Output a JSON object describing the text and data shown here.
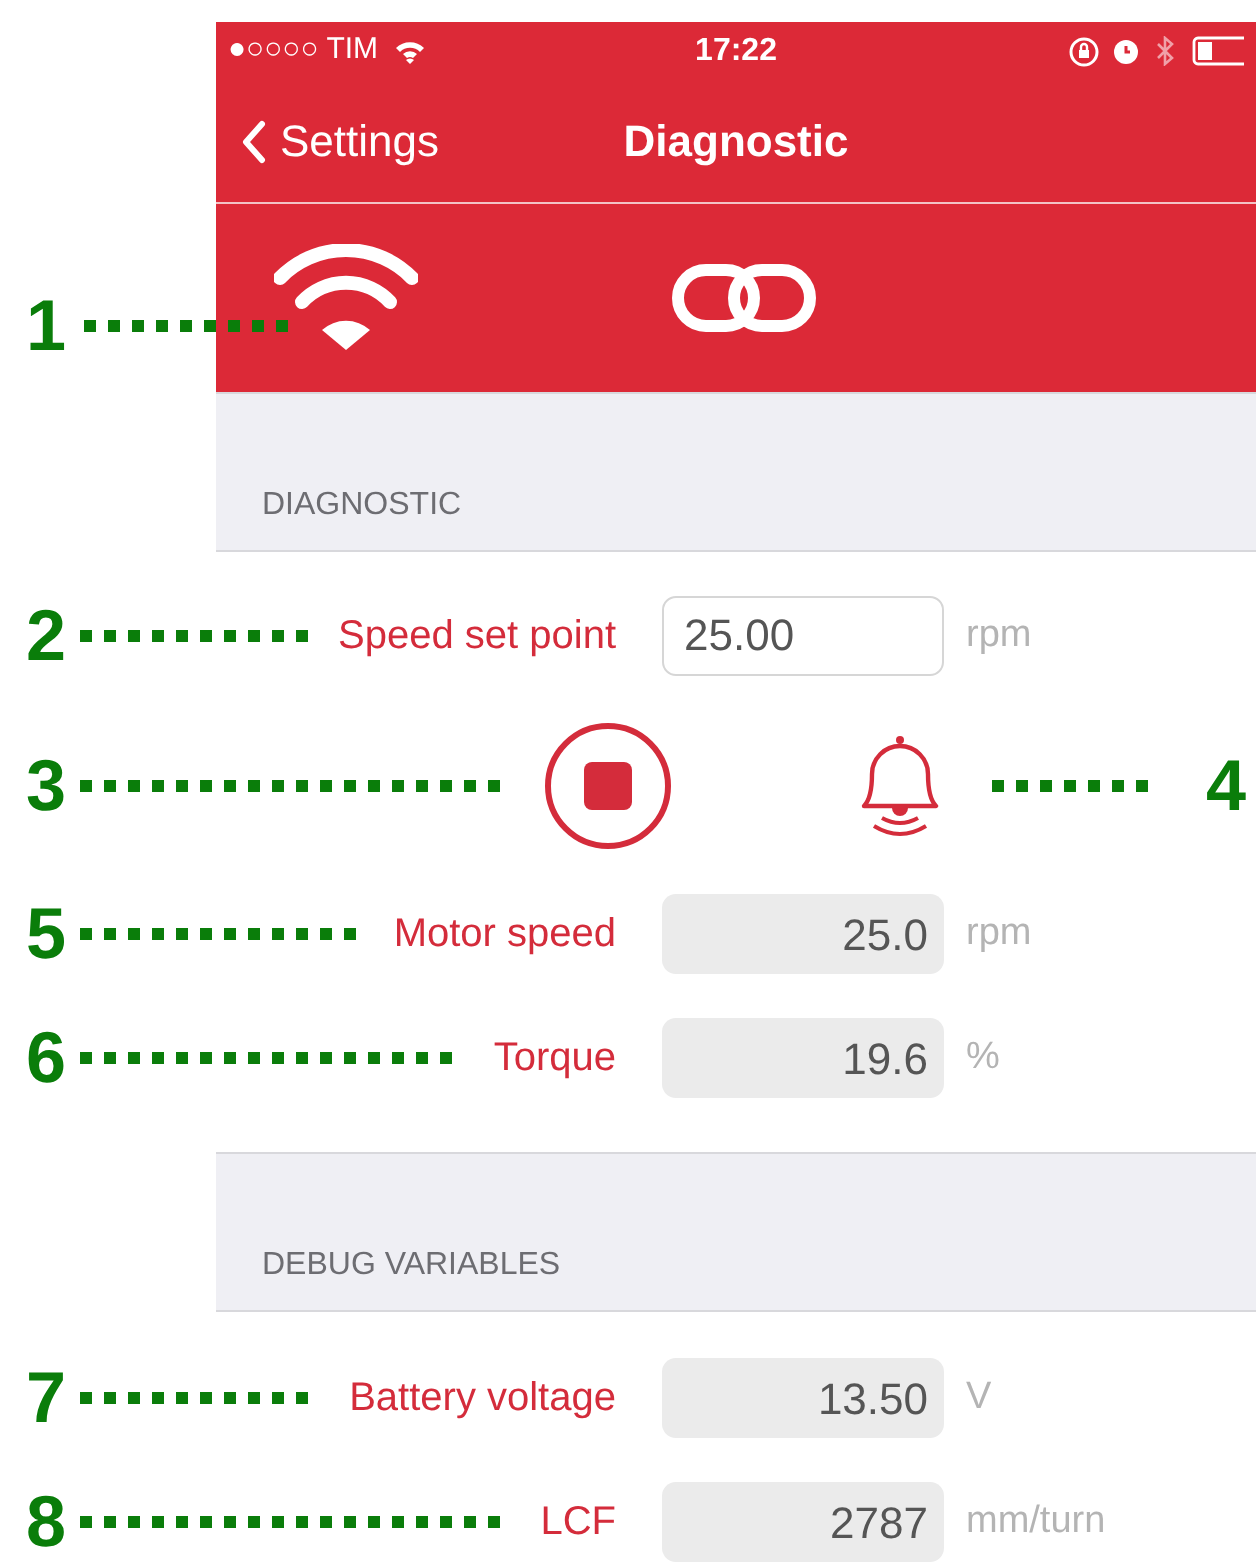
{
  "status_bar": {
    "carrier": "●○○○○ TIM",
    "time": "17:22"
  },
  "nav_bar": {
    "back": "Settings",
    "title": "Diagnostic"
  },
  "toolbar": {
    "callout": "1"
  },
  "sections": [
    {
      "header": "DIAGNOSTIC",
      "rows": [
        {
          "kind": "input",
          "callout": "2",
          "label": "Speed set point",
          "value": "25.00",
          "unit": "rpm"
        },
        {
          "kind": "actions",
          "callouts": [
            "3",
            "4"
          ]
        },
        {
          "kind": "readout",
          "callout": "5",
          "label": "Motor speed",
          "value": "25.0",
          "unit": "rpm"
        },
        {
          "kind": "readout",
          "callout": "6",
          "label": "Torque",
          "value": "19.6",
          "unit": "%"
        }
      ]
    },
    {
      "header": "DEBUG VARIABLES",
      "rows": [
        {
          "kind": "readout",
          "callout": "7",
          "label": "Battery voltage",
          "value": "13.50",
          "unit": "V"
        },
        {
          "kind": "readout",
          "callout": "8",
          "label": "LCF",
          "value": "2787",
          "unit": "mm/turn"
        }
      ]
    }
  ]
}
